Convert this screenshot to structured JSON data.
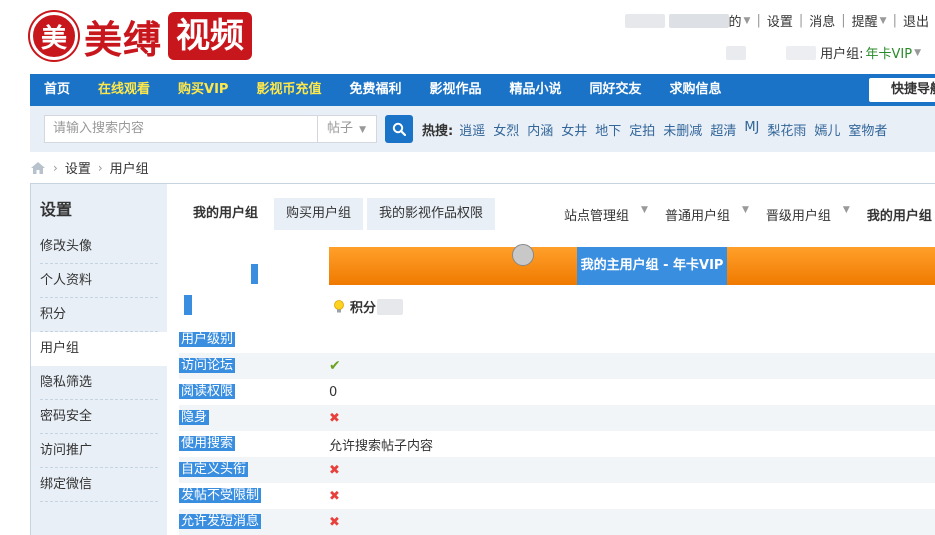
{
  "site": {
    "logo_seal": "美",
    "logo_text_1": "美缚",
    "logo_text_2": "视频"
  },
  "toplinks": {
    "user_suffix": "的",
    "settings": "设置",
    "messages": "消息",
    "reminder": "提醒",
    "logout": "退出"
  },
  "usergroup": {
    "label": "用户组:",
    "value": "年卡VIP"
  },
  "nav": {
    "items": [
      {
        "label": "首页",
        "highlight": false
      },
      {
        "label": "在线观看",
        "highlight": true
      },
      {
        "label": "购买VIP",
        "highlight": true
      },
      {
        "label": "影视币充值",
        "highlight": true
      },
      {
        "label": "免费福利",
        "highlight": false
      },
      {
        "label": "影视作品",
        "highlight": false
      },
      {
        "label": "精品小说",
        "highlight": false
      },
      {
        "label": "同好交友",
        "highlight": false
      },
      {
        "label": "求购信息",
        "highlight": false
      }
    ],
    "quick_nav": "快捷导航"
  },
  "search": {
    "placeholder": "请输入搜索内容",
    "category": "帖子",
    "hot_label": "热搜:",
    "hot_words": [
      "逍遥",
      "女烈",
      "内涵",
      "女井",
      "地下",
      "定拍",
      "未删减",
      "超清",
      "MJ",
      "梨花雨",
      "嫣儿",
      "窒物者"
    ]
  },
  "breadcrumb": {
    "items": [
      "设置",
      "用户组"
    ]
  },
  "sidebar": {
    "title": "设置",
    "items": [
      {
        "label": "修改头像",
        "active": false
      },
      {
        "label": "个人资料",
        "active": false
      },
      {
        "label": "积分",
        "active": false
      },
      {
        "label": "用户组",
        "active": true
      },
      {
        "label": "隐私筛选",
        "active": false
      },
      {
        "label": "密码安全",
        "active": false
      },
      {
        "label": "访问推广",
        "active": false
      },
      {
        "label": "绑定微信",
        "active": false
      }
    ]
  },
  "tabs": [
    {
      "label": "我的用户组",
      "active": true
    },
    {
      "label": "购买用户组",
      "active": false
    },
    {
      "label": "我的影视作品权限",
      "active": false
    }
  ],
  "group_tabs": [
    {
      "label": "站点管理组"
    },
    {
      "label": "普通用户组"
    },
    {
      "label": "晋级用户组"
    },
    {
      "label": "我的用户组",
      "current": true
    }
  ],
  "banner": {
    "title": "我的主用户组 - 年卡VIP"
  },
  "credits": {
    "label": "积分"
  },
  "permissions": [
    {
      "key": "用户级别",
      "value": "",
      "type": "text"
    },
    {
      "key": "访问论坛",
      "value": "",
      "type": "check"
    },
    {
      "key": "阅读权限",
      "value": "0",
      "type": "text"
    },
    {
      "key": "隐身",
      "value": "",
      "type": "cross"
    },
    {
      "key": "使用搜索",
      "value": "允许搜索帖子内容",
      "type": "text"
    },
    {
      "key": "自定义头衔",
      "value": "",
      "type": "cross"
    },
    {
      "key": "发帖不受限制",
      "value": "",
      "type": "cross"
    },
    {
      "key": "允许发短消息",
      "value": "",
      "type": "cross"
    }
  ],
  "icons": {
    "search": "search-icon",
    "home": "home-icon",
    "bulb": "lightbulb-icon",
    "check": "check-icon",
    "cross": "cross-icon"
  },
  "colors": {
    "brand_red": "#c8161d",
    "nav_blue": "#1a73c7",
    "nav_highlight": "#ffe84a",
    "banner_orange": "#f07a00",
    "vip_green": "#2a8a2a"
  }
}
